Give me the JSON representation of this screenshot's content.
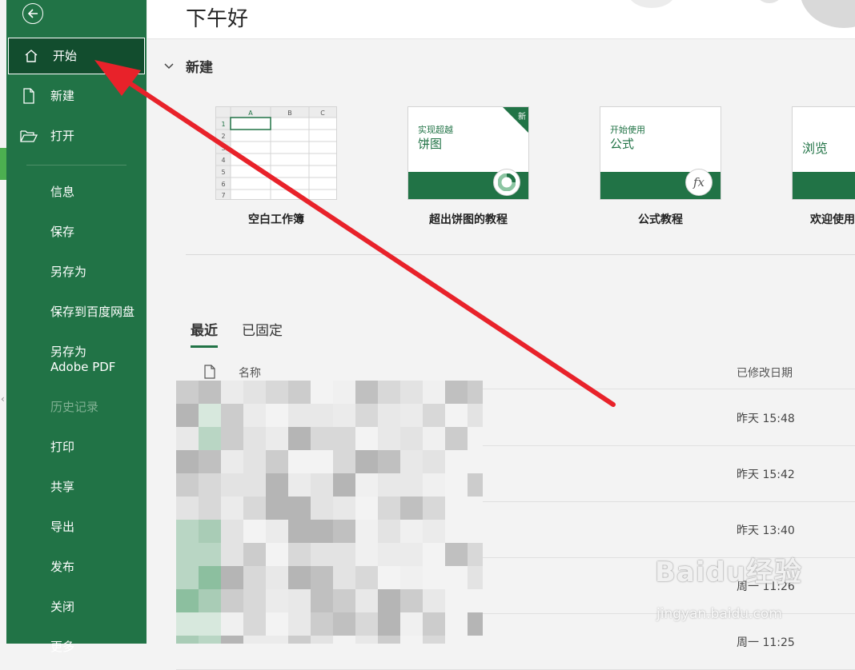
{
  "sidebar": {
    "items": [
      {
        "label": "开始",
        "icon": "home-icon",
        "active": true
      },
      {
        "label": "新建",
        "icon": "new-document-icon"
      },
      {
        "label": "打开",
        "icon": "open-folder-icon"
      },
      {
        "label": "信息"
      },
      {
        "label": "保存"
      },
      {
        "label": "另存为"
      },
      {
        "label": "保存到百度网盘"
      },
      {
        "label": "另存为 Adobe PDF"
      },
      {
        "label": "历史记录",
        "disabled": true
      },
      {
        "label": "打印"
      },
      {
        "label": "共享"
      },
      {
        "label": "导出"
      },
      {
        "label": "发布"
      },
      {
        "label": "关闭"
      },
      {
        "label": "更多"
      }
    ]
  },
  "main": {
    "greeting": "下午好",
    "new_section": {
      "title": "新建",
      "templates": [
        {
          "caption": "空白工作簿",
          "kind": "blank",
          "grid": {
            "cols": [
              "A",
              "B",
              "C"
            ],
            "rows": [
              "1",
              "2",
              "3",
              "4",
              "5",
              "6",
              "7"
            ]
          }
        },
        {
          "caption": "超出饼图的教程",
          "small": "实现超越",
          "big": "饼图",
          "badge": "新"
        },
        {
          "caption": "公式教程",
          "small": "开始使用",
          "big": "公式",
          "symbol": "fx"
        },
        {
          "caption": "欢迎使用",
          "big": "浏览"
        }
      ]
    },
    "tabs": [
      {
        "label": "最近",
        "active": true
      },
      {
        "label": "已固定"
      }
    ],
    "columns": {
      "name": "名称",
      "modified": "已修改日期"
    },
    "files": [
      {
        "modified": "昨天 15:48"
      },
      {
        "modified": "昨天 15:42"
      },
      {
        "modified": "昨天 13:40"
      },
      {
        "modified": "周一 11:26"
      },
      {
        "modified": "周一 11:25"
      }
    ]
  },
  "watermark": {
    "brand": "Baidu经验",
    "url": "jingyan.baidu.com"
  },
  "colors": {
    "accent": "#217346",
    "active_bg": "#124d2e",
    "arrow": "#e8222a"
  }
}
